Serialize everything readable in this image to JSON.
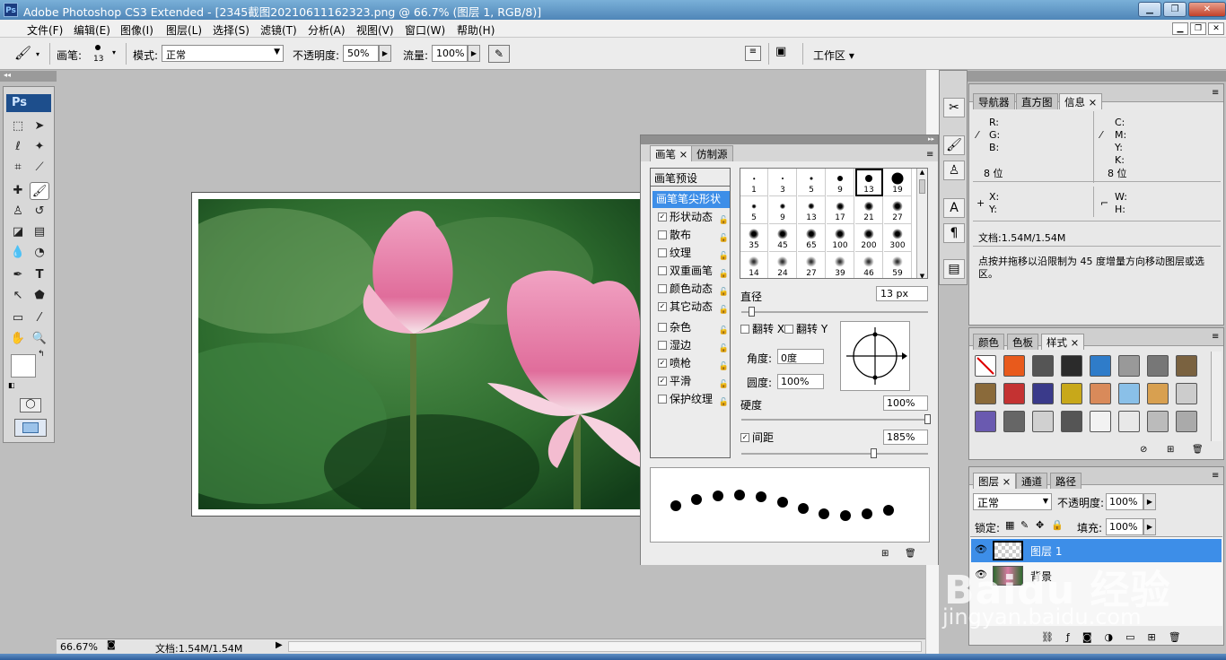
{
  "titlebar": {
    "title": "Adobe Photoshop CS3 Extended - [2345截图20210611162323.png @ 66.7% (图层 1, RGB/8)]",
    "min": "▁",
    "max": "❐",
    "close": "✕"
  },
  "menu": [
    "文件(F)",
    "编辑(E)",
    "图像(I)",
    "图层(L)",
    "选择(S)",
    "滤镜(T)",
    "分析(A)",
    "视图(V)",
    "窗口(W)",
    "帮助(H)"
  ],
  "options": {
    "brush_label": "画笔:",
    "brush_size": "13",
    "mode_label": "模式:",
    "mode_value": "正常",
    "opacity_label": "不透明度:",
    "opacity_value": "50%",
    "flow_label": "流量:",
    "flow_value": "100%",
    "workspace_label": "工作区 ▾"
  },
  "toolbox": {
    "logo": "Ps"
  },
  "status": {
    "zoom": "66.67%",
    "doc": "文档:1.54M/1.54M"
  },
  "brush_panel": {
    "tabs": [
      "画笔",
      "仿制源"
    ],
    "section_title": "画笔预设",
    "options": [
      {
        "label": "画笔笔尖形状",
        "selected": true,
        "checkbox": false,
        "checked": false,
        "lock": false
      },
      {
        "label": "形状动态",
        "checkbox": true,
        "checked": true,
        "lock": true
      },
      {
        "label": "散布",
        "checkbox": true,
        "checked": false,
        "lock": true
      },
      {
        "label": "纹理",
        "checkbox": true,
        "checked": false,
        "lock": true
      },
      {
        "label": "双重画笔",
        "checkbox": true,
        "checked": false,
        "lock": true
      },
      {
        "label": "颜色动态",
        "checkbox": true,
        "checked": false,
        "lock": true
      },
      {
        "label": "其它动态",
        "checkbox": true,
        "checked": true,
        "lock": true
      },
      {
        "label": "杂色",
        "checkbox": true,
        "checked": false,
        "lock": true
      },
      {
        "label": "湿边",
        "checkbox": true,
        "checked": false,
        "lock": true
      },
      {
        "label": "喷枪",
        "checkbox": true,
        "checked": true,
        "lock": true
      },
      {
        "label": "平滑",
        "checkbox": true,
        "checked": true,
        "lock": true
      },
      {
        "label": "保护纹理",
        "checkbox": true,
        "checked": false,
        "lock": true
      }
    ],
    "presets": [
      "1",
      "3",
      "5",
      "9",
      "13",
      "19",
      "5",
      "9",
      "13",
      "17",
      "21",
      "27",
      "35",
      "45",
      "65",
      "100",
      "200",
      "300",
      "14",
      "24",
      "27",
      "39",
      "46",
      "59"
    ],
    "diameter_label": "直径",
    "diameter_value": "13 px",
    "flip_x": "翻转 X",
    "flip_y": "翻转 Y",
    "angle_label": "角度:",
    "angle_value": "0度",
    "roundness_label": "圆度:",
    "roundness_value": "100%",
    "hardness_label": "硬度",
    "hardness_value": "100%",
    "spacing_label": "间距",
    "spacing_value": "185%"
  },
  "nav_panel": {
    "tabs": [
      "导航器",
      "直方图",
      "信息"
    ],
    "rgb": [
      "R:",
      "G:",
      "B:"
    ],
    "cmyk": [
      "C:",
      "M:",
      "Y:",
      "K:"
    ],
    "bits_left": "8 位",
    "bits_right": "8 位",
    "xy": [
      "X:",
      "Y:"
    ],
    "wh": [
      "W:",
      "H:"
    ],
    "doc": "文档:1.54M/1.54M",
    "hint": "点按并拖移以沿限制为 45 度增量方向移动图层或选区。"
  },
  "swatch_panel": {
    "tabs": [
      "颜色",
      "色板",
      "样式"
    ]
  },
  "layers_panel": {
    "tabs": [
      "图层",
      "通道",
      "路径"
    ],
    "blend": "正常",
    "opacity_label": "不透明度:",
    "opacity_value": "100%",
    "lock_label": "锁定:",
    "fill_label": "填充:",
    "fill_value": "100%",
    "layers": [
      {
        "name": "图层 1"
      },
      {
        "name": "背景"
      }
    ]
  },
  "watermark": {
    "line1": "Baidu 经验",
    "line2": "jingyan.baidu.com"
  }
}
